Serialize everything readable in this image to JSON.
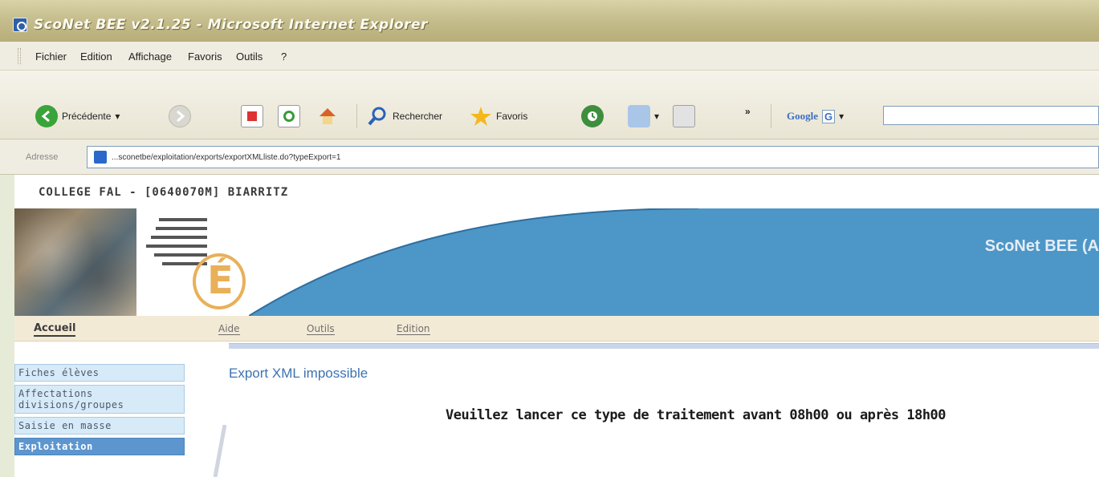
{
  "window": {
    "title": "ScoNet BEE v2.1.25 - Microsoft Internet Explorer"
  },
  "menubar": {
    "items": [
      "Fichier",
      "Edition",
      "Affichage",
      "Favoris",
      "Outils",
      "?"
    ]
  },
  "toolbar": {
    "back_label": "Précédente",
    "search_label": "Rechercher",
    "favorites_label": "Favoris",
    "more_label": "»",
    "google_label": "Google",
    "google_g": "G"
  },
  "address": {
    "label": "Adresse",
    "url": "...sconetbe/exploitation/exports/exportXMLliste.do?typeExport=1"
  },
  "page": {
    "school": "COLLEGE FAL - [0640070M] BIARRITZ",
    "app_name": "ScoNet BEE (A",
    "logo_letter": "É",
    "nav": {
      "home": "Accueil",
      "items": [
        "Aide",
        "Outils",
        "Edition"
      ]
    },
    "sidebar": {
      "items": [
        "Fiches élèves",
        "Affectations divisions/groupes",
        "Saisie en masse",
        "Exploitation"
      ]
    },
    "title": "Export XML impossible",
    "message": "Veuillez lancer ce type de traitement avant 08h00 ou après 18h00"
  },
  "colors": {
    "banner_blue": "#4c97c8",
    "link_blue": "#3d72b2",
    "logo_gold": "#e9b05a",
    "sidebar_active": "#5d96cf"
  }
}
